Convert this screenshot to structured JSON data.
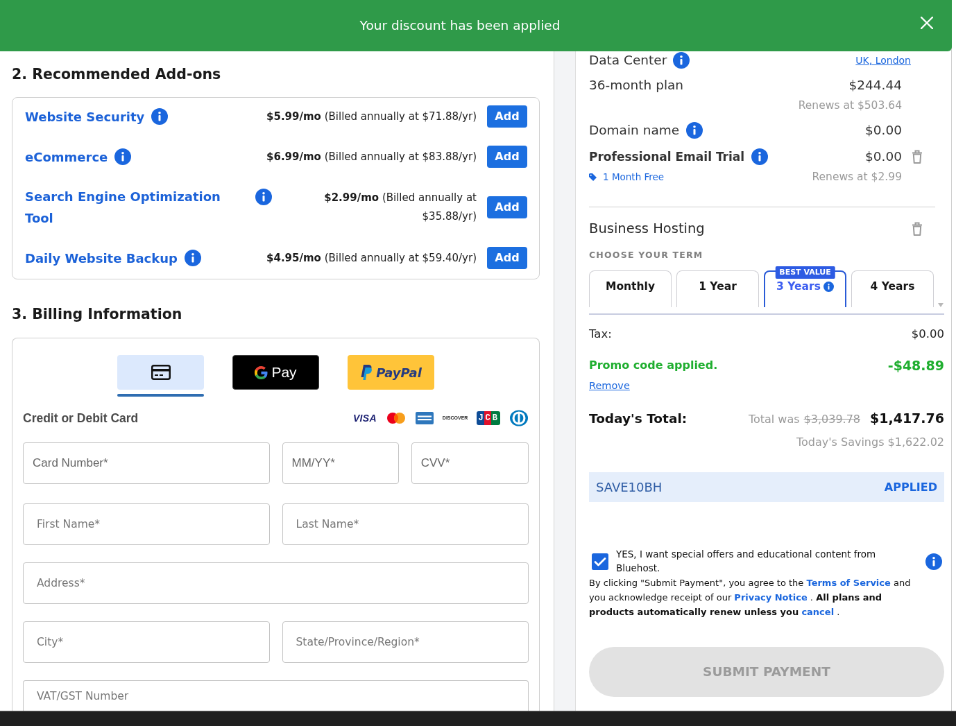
{
  "toast": {
    "message": "Your discount has been applied"
  },
  "addons": {
    "heading": "2. Recommended Add-ons",
    "items": [
      {
        "name": "Website Security",
        "price": "$5.99/mo",
        "billing": "(Billed annually at $71.88/yr)",
        "button": "Add"
      },
      {
        "name": "eCommerce",
        "price": "$6.99/mo",
        "billing": "(Billed annually at $83.88/yr)",
        "button": "Add"
      },
      {
        "name": "Search Engine Optimization Tool",
        "price": "$2.99/mo",
        "billing": "(Billed annually at $35.88/yr)",
        "button": "Add"
      },
      {
        "name": "Daily Website Backup",
        "price": "$4.95/mo",
        "billing": "(Billed annually at $59.40/yr)",
        "button": "Add"
      }
    ]
  },
  "billing": {
    "heading": "3. Billing Information",
    "payment_methods": [
      {
        "kind": "card",
        "selected": true
      },
      {
        "kind": "google_pay",
        "label": "Pay",
        "selected": false
      },
      {
        "kind": "paypal",
        "label": "PayPal",
        "selected": false
      }
    ],
    "card_label": "Credit or Debit Card",
    "card_brands": [
      {
        "kind": "visa",
        "label": "VISA"
      },
      {
        "kind": "mastercard"
      },
      {
        "kind": "amex"
      },
      {
        "kind": "discover",
        "label": "DISCOVER"
      },
      {
        "kind": "jcb",
        "label": "JCB"
      },
      {
        "kind": "diners"
      }
    ],
    "field_rows": [
      {
        "kind": "card",
        "fields": [
          {
            "placeholder": "Card Number*"
          },
          {
            "placeholder": "MM/YY*"
          },
          {
            "placeholder": "CVV*"
          }
        ]
      },
      {
        "kind": "text",
        "fields": [
          {
            "placeholder": "First Name*"
          },
          {
            "placeholder": "Last Name*"
          }
        ]
      },
      {
        "kind": "text",
        "fields": [
          {
            "placeholder": "Address*"
          }
        ]
      },
      {
        "kind": "text",
        "fields": [
          {
            "placeholder": "City*"
          },
          {
            "placeholder": "State/Province/Region*"
          }
        ]
      },
      {
        "kind": "text",
        "fields": [
          {
            "placeholder": "VAT/GST Number"
          }
        ]
      }
    ]
  },
  "order_summary": {
    "data_center": {
      "label": "Data Center",
      "value": "UK, London"
    },
    "lines": [
      {
        "label": "36-month plan",
        "price": "$244.44",
        "renews": "Renews at $503.64",
        "info": false,
        "bold": false,
        "removable": false
      },
      {
        "label": "Domain name",
        "price": "$0.00",
        "info": true,
        "bold": false,
        "removable": false
      },
      {
        "label": "Professional Email Trial",
        "price": "$0.00",
        "info": true,
        "bold": true,
        "removable": true,
        "promo": "1 Month Free",
        "renews": "Renews at $2.99"
      }
    ],
    "hosting": {
      "title": "Business Hosting",
      "removable": true,
      "term_label": "CHOOSE YOUR TERM",
      "terms": [
        {
          "label": "Monthly",
          "selected": false,
          "info": false
        },
        {
          "label": "1 Year",
          "selected": false,
          "info": false
        },
        {
          "label": "3 Years",
          "selected": true,
          "info": true,
          "badge": "BEST VALUE"
        },
        {
          "label": "4 Years",
          "selected": false,
          "info": false
        }
      ]
    },
    "tax": {
      "label": "Tax:",
      "value": "$0.00"
    },
    "promo": {
      "label": "Promo code applied.",
      "value": "-$48.89",
      "remove": "Remove"
    },
    "total": {
      "label": "Today's Total:",
      "was_label": "Total was",
      "was_value": "$3,039.78",
      "value": "$1,417.76",
      "savings": "Today's Savings $1,622.02"
    },
    "coupon": {
      "code": "SAVE10BH",
      "status": "APPLIED"
    },
    "consent": {
      "text": "YES, I want special offers and educational content from Bluehost.",
      "checked": true
    },
    "legal": [
      {
        "kind": "text",
        "text": "By clicking \"Submit Payment\", you agree to the "
      },
      {
        "kind": "link",
        "text": "Terms of Service"
      },
      {
        "kind": "text",
        "text": " and you acknowledge receipt of our "
      },
      {
        "kind": "link",
        "text": "Privacy Notice"
      },
      {
        "kind": "text",
        "text": " .  **All plans and products automatically renew unless you** "
      },
      {
        "kind": "link",
        "text": "cancel"
      },
      {
        "kind": "text",
        "text": " ."
      }
    ],
    "submit": {
      "label": "SUBMIT PAYMENT",
      "disabled": true
    }
  }
}
